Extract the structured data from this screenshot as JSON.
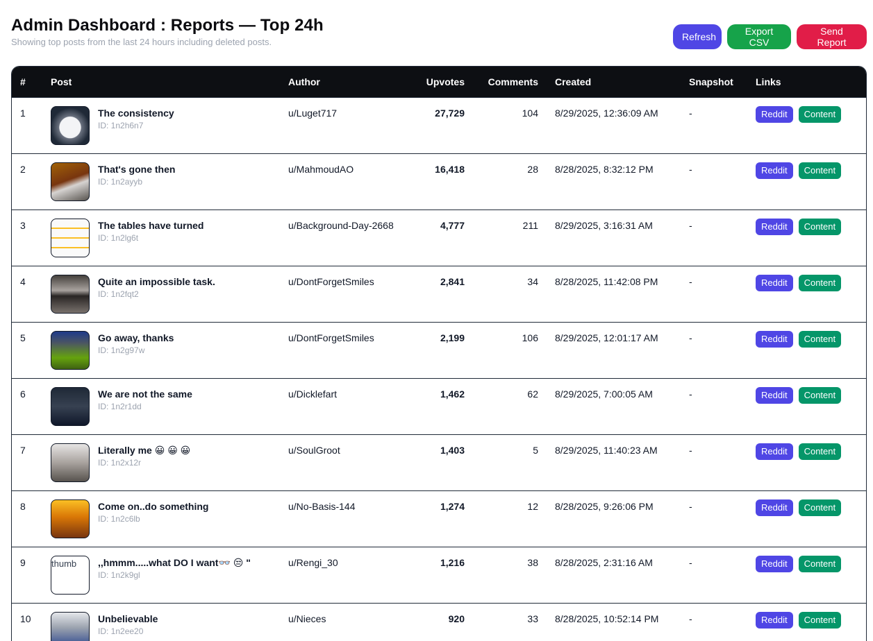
{
  "header": {
    "title": "Admin Dashboard : Reports — Top 24h",
    "subtitle": "Showing top posts from the last 24 hours including deleted posts."
  },
  "actions": {
    "refresh": "Refresh",
    "export": "Export CSV",
    "send": "Send Report"
  },
  "table": {
    "columns": [
      "#",
      "Post",
      "Author",
      "Upvotes",
      "Comments",
      "Created",
      "Snapshot",
      "Links"
    ],
    "link_labels": {
      "reddit": "Reddit",
      "content": "Content"
    },
    "broken_thumb_alt": "thumb",
    "rows": [
      {
        "rank": "1",
        "title": "The consistency",
        "id": "ID: 1n2h6n7",
        "author": "u/Luget717",
        "upvotes": "27,729",
        "comments": "104",
        "created": "8/29/2025, 12:36:09 AM",
        "snapshot": "-",
        "thumb": "cake"
      },
      {
        "rank": "2",
        "title": "That's gone then",
        "id": "ID: 1n2ayyb",
        "author": "u/MahmoudAO",
        "upvotes": "16,418",
        "comments": "28",
        "created": "8/28/2025, 8:32:12 PM",
        "snapshot": "-",
        "thumb": "brown"
      },
      {
        "rank": "3",
        "title": "The tables have turned",
        "id": "ID: 1n2lg6t",
        "author": "u/Background-Day-2668",
        "upvotes": "4,777",
        "comments": "211",
        "created": "8/29/2025, 3:16:31 AM",
        "snapshot": "-",
        "thumb": "grid"
      },
      {
        "rank": "4",
        "title": "Quite an impossible task.",
        "id": "ID: 1n2fqt2",
        "author": "u/DontForgetSmiles",
        "upvotes": "2,841",
        "comments": "34",
        "created": "8/28/2025, 11:42:08 PM",
        "snapshot": "-",
        "thumb": "dark"
      },
      {
        "rank": "5",
        "title": "Go away, thanks",
        "id": "ID: 1n2g97w",
        "author": "u/DontForgetSmiles",
        "upvotes": "2,199",
        "comments": "106",
        "created": "8/29/2025, 12:01:17 AM",
        "snapshot": "-",
        "thumb": "green"
      },
      {
        "rank": "6",
        "title": "We are not the same",
        "id": "ID: 1n2r1dd",
        "author": "u/Dicklefart",
        "upvotes": "1,462",
        "comments": "62",
        "created": "8/29/2025, 7:00:05 AM",
        "snapshot": "-",
        "thumb": "suit"
      },
      {
        "rank": "7",
        "title": "Literally me 😀 😀 😀",
        "id": "ID: 1n2x12r",
        "author": "u/SoulGroot",
        "upvotes": "1,403",
        "comments": "5",
        "created": "8/29/2025, 11:40:23 AM",
        "snapshot": "-",
        "thumb": "tan"
      },
      {
        "rank": "8",
        "title": "Come on..do something",
        "id": "ID: 1n2c6lb",
        "author": "u/No-Basis-144",
        "upvotes": "1,274",
        "comments": "12",
        "created": "8/28/2025, 9:26:06 PM",
        "snapshot": "-",
        "thumb": "yellow"
      },
      {
        "rank": "9",
        "title": ",,hmmm.....what DO I want👓 😒 \"",
        "id": "ID: 1n2k9gl",
        "author": "u/Rengi_30",
        "upvotes": "1,216",
        "comments": "38",
        "created": "8/28/2025, 2:31:16 AM",
        "snapshot": "-",
        "thumb": "broken"
      },
      {
        "rank": "10",
        "title": "Unbelievable",
        "id": "ID: 1n2ee20",
        "author": "u/Nieces",
        "upvotes": "920",
        "comments": "33",
        "created": "8/28/2025, 10:52:14 PM",
        "snapshot": "-",
        "thumb": "people"
      }
    ]
  }
}
